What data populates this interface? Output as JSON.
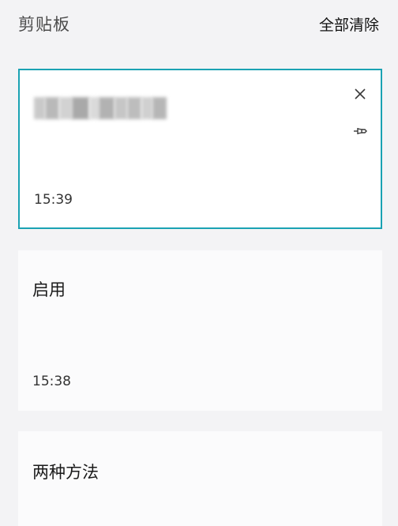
{
  "header": {
    "title": "剪贴板",
    "clear_all": "全部清除"
  },
  "items": [
    {
      "text": "",
      "time": "15:39",
      "selected": true,
      "blurred": true
    },
    {
      "text": "启用",
      "time": "15:38",
      "selected": false
    },
    {
      "text": "两种方法",
      "time": "",
      "selected": false
    }
  ],
  "colors": {
    "accent_border": "#1aa2b3",
    "background": "#f3f3f5",
    "card": "#fbfbfc"
  },
  "icons": {
    "close": "close-icon",
    "pin": "pin-icon"
  }
}
